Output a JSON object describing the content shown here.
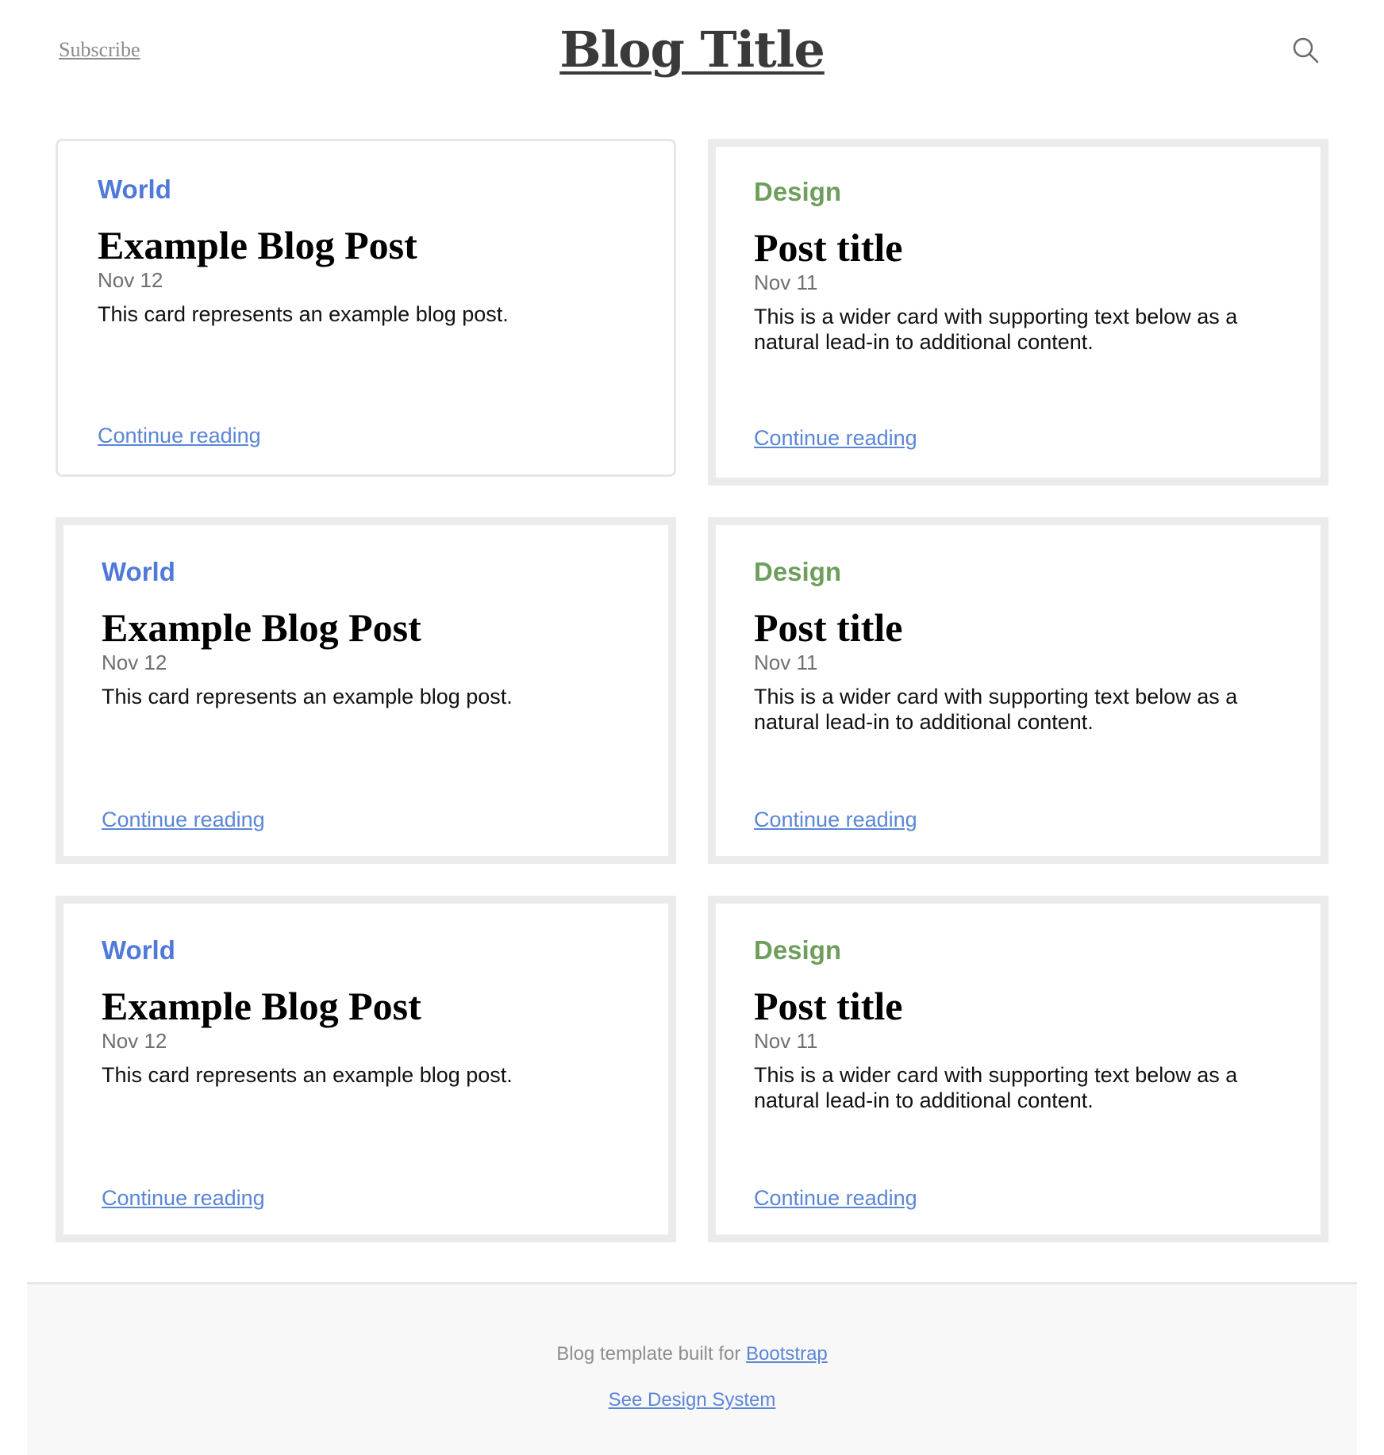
{
  "header": {
    "subscribe_label": "Subscribe",
    "blog_title": "Blog Title",
    "search_icon": "search-icon"
  },
  "cards": [
    {
      "category": "World",
      "title": "Example Blog Post",
      "date": "Nov 12",
      "text": "This card represents an example blog post.",
      "link": "Continue reading"
    },
    {
      "category": "Design",
      "title": "Post title",
      "date": "Nov 11",
      "text": "This is a wider card with supporting text below as a natural lead-in to additional content.",
      "link": "Continue reading"
    },
    {
      "category": "World",
      "title": "Example Blog Post",
      "date": "Nov 12",
      "text": "This card represents an example blog post.",
      "link": "Continue reading"
    },
    {
      "category": "Design",
      "title": "Post title",
      "date": "Nov 11",
      "text": "This is a wider card with supporting text below as a natural lead-in to additional content.",
      "link": "Continue reading"
    },
    {
      "category": "World",
      "title": "Example Blog Post",
      "date": "Nov 12",
      "text": "This card represents an example blog post.",
      "link": "Continue reading"
    },
    {
      "category": "Design",
      "title": "Post title",
      "date": "Nov 11",
      "text": "This is a wider card with supporting text below as a natural lead-in to additional content.",
      "link": "Continue reading"
    }
  ],
  "footer": {
    "built_text": "Blog template built for",
    "bootstrap_link": "Bootstrap",
    "design_system_link": "See Design System"
  },
  "colors": {
    "world_category": "#5079d9",
    "design_category": "#6e9e5c",
    "link": "#5b86d6",
    "card_border": "#ebebeb",
    "footer_bg": "#f8f8f8"
  }
}
